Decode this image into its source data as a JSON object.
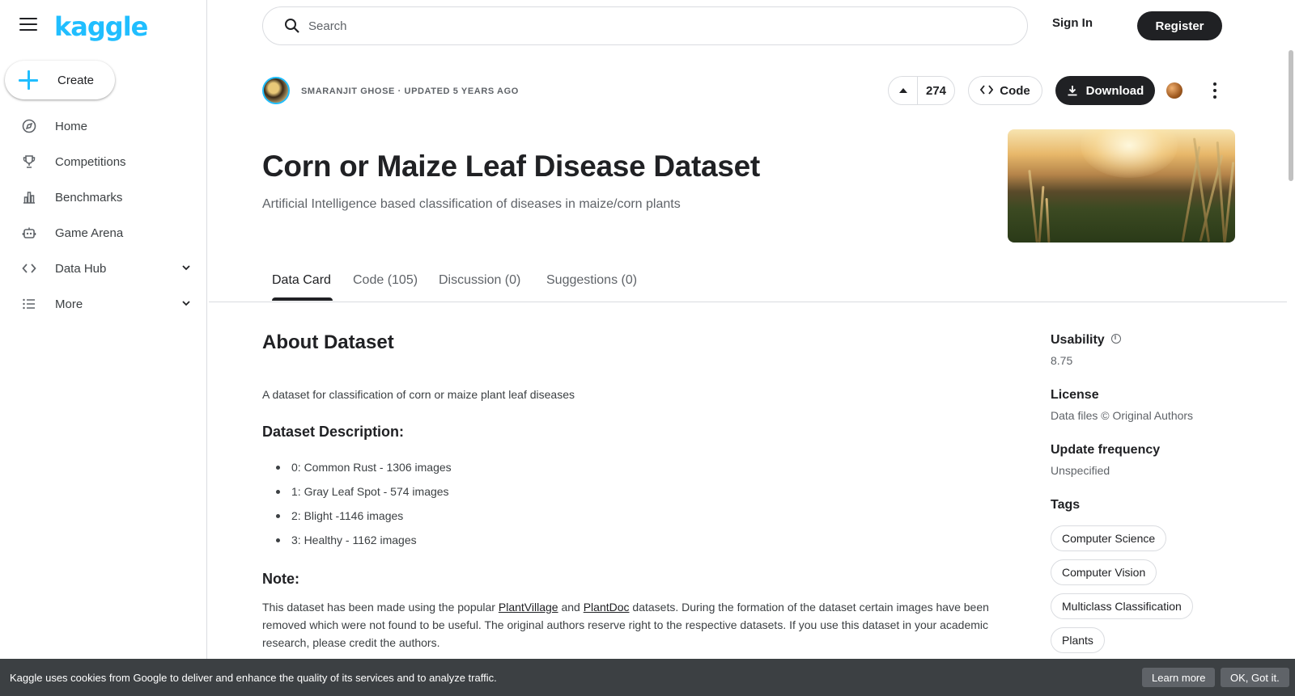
{
  "brand": {
    "logo_text": "kaggle",
    "accent": "#20beff"
  },
  "sidebar": {
    "create_label": "Create",
    "items": [
      {
        "label": "Home",
        "icon": "compass-icon"
      },
      {
        "label": "Competitions",
        "icon": "trophy-icon"
      },
      {
        "label": "Benchmarks",
        "icon": "bar-chart-icon"
      },
      {
        "label": "Game Arena",
        "icon": "robot-icon"
      },
      {
        "label": "Data Hub",
        "icon": "code-brackets-icon",
        "expandable": true
      },
      {
        "label": "More",
        "icon": "list-icon",
        "expandable": true
      }
    ]
  },
  "topbar": {
    "search_placeholder": "Search",
    "signin_label": "Sign In",
    "register_label": "Register"
  },
  "dataset": {
    "author_line": "SMARANJIT GHOSE · UPDATED 5 YEARS AGO",
    "upvotes": "274",
    "code_label": "Code",
    "download_label": "Download",
    "title": "Corn or Maize Leaf Disease Dataset",
    "subtitle": "Artificial Intelligence based classification of diseases in maize/corn plants"
  },
  "tabs": [
    {
      "label": "Data Card",
      "active": true
    },
    {
      "label": "Code (105)"
    },
    {
      "label": "Discussion (0)"
    },
    {
      "label": "Suggestions (0)"
    }
  ],
  "content": {
    "about_heading": "About Dataset",
    "description": "A dataset for classification of corn or maize plant leaf diseases",
    "desc_heading": "Dataset Description:",
    "classes": [
      "0: Common Rust - 1306 images",
      "1: Gray Leaf Spot - 574 images",
      "2: Blight -1146 images",
      "3: Healthy - 1162 images"
    ],
    "note_heading": "Note:",
    "note_part1": "This dataset has been made using the popular ",
    "note_link1": "PlantVillage",
    "note_part2": " and ",
    "note_link2": "PlantDoc",
    "note_part3": " datasets. During the formation of the dataset certain images have been removed which were not found to be useful. The original authors reserve right to the respective datasets. If you use this dataset in your academic research, please credit the authors."
  },
  "metadata": {
    "usability_label": "Usability",
    "usability_value": "8.75",
    "license_label": "License",
    "license_value": "Data files © Original Authors",
    "update_label": "Update frequency",
    "update_value": "Unspecified",
    "tags_label": "Tags",
    "tags": [
      "Computer Science",
      "Computer Vision",
      "Multiclass Classification",
      "Plants"
    ]
  },
  "cookie": {
    "text": "Kaggle uses cookies from Google to deliver and enhance the quality of its services and to analyze traffic.",
    "learn_more": "Learn more",
    "ok": "OK, Got it."
  }
}
